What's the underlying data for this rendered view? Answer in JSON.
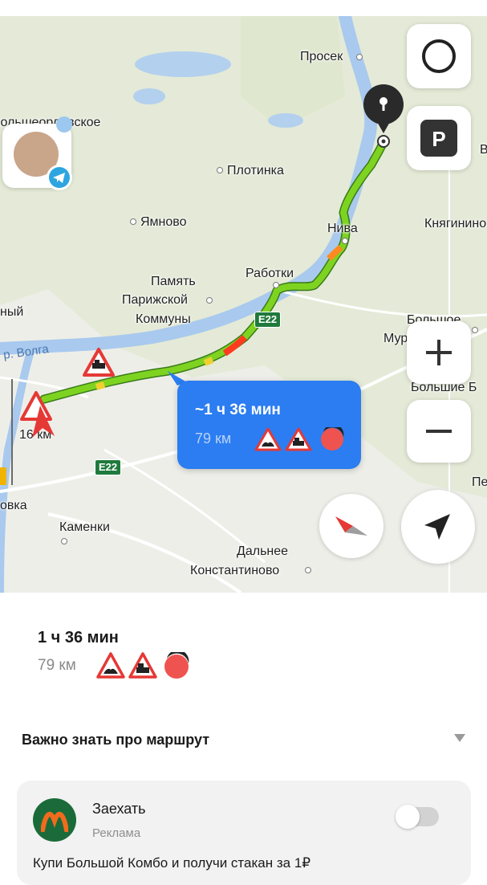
{
  "map": {
    "places": [
      {
        "id": "prosek",
        "text": "Просек"
      },
      {
        "id": "bolsheorlovskoe",
        "text": "Большеорловское"
      },
      {
        "id": "plotinka",
        "text": "Плотинка"
      },
      {
        "id": "yamnovo",
        "text": "Ямново"
      },
      {
        "id": "niva",
        "text": "Нива"
      },
      {
        "id": "knyaginino",
        "text": "Княгинино"
      },
      {
        "id": "pamyat",
        "text": "Память"
      },
      {
        "id": "parizhskoy",
        "text": "Парижской"
      },
      {
        "id": "kommuny",
        "text": "Коммуны"
      },
      {
        "id": "rabotki",
        "text": "Работки"
      },
      {
        "id": "bolshoe",
        "text": "Большое"
      },
      {
        "id": "murashkino",
        "text": "Мурашкино"
      },
      {
        "id": "bolshie",
        "text": "Большие Б"
      },
      {
        "id": "pe",
        "text": "Пе"
      },
      {
        "id": "v",
        "text": "В"
      },
      {
        "id": "ny",
        "text": "ный"
      },
      {
        "id": "ovka",
        "text": "овка"
      },
      {
        "id": "kamenki",
        "text": "Каменки"
      },
      {
        "id": "dalnee",
        "text": "Дальнее"
      },
      {
        "id": "konstantinovo",
        "text": "Константиново"
      }
    ],
    "river_label": "р. Волга",
    "highways": [
      "E22",
      "E22"
    ],
    "scale_label": "16 км",
    "route_bubble": {
      "time": "~1 ч 36 мин",
      "distance": "79 км"
    },
    "route_color": "#7ed321",
    "route_jam_color": "#ff3b1f",
    "bubble_color": "#2b7df1",
    "icons": [
      "alice-icon",
      "parking-icon",
      "zoom-in-icon",
      "zoom-out-icon",
      "compass-icon",
      "location-arrow-icon",
      "destination-pin-icon",
      "telegram-icon"
    ]
  },
  "sheet": {
    "time": "1 ч 36 мин",
    "distance": "79 км",
    "important_title": "Важно знать про маршрут",
    "ad": {
      "title": "Заехать",
      "subtitle": "Реклама",
      "body": "Купи Большой Комбо и получи стакан за 1₽",
      "toggle_on": false
    }
  }
}
